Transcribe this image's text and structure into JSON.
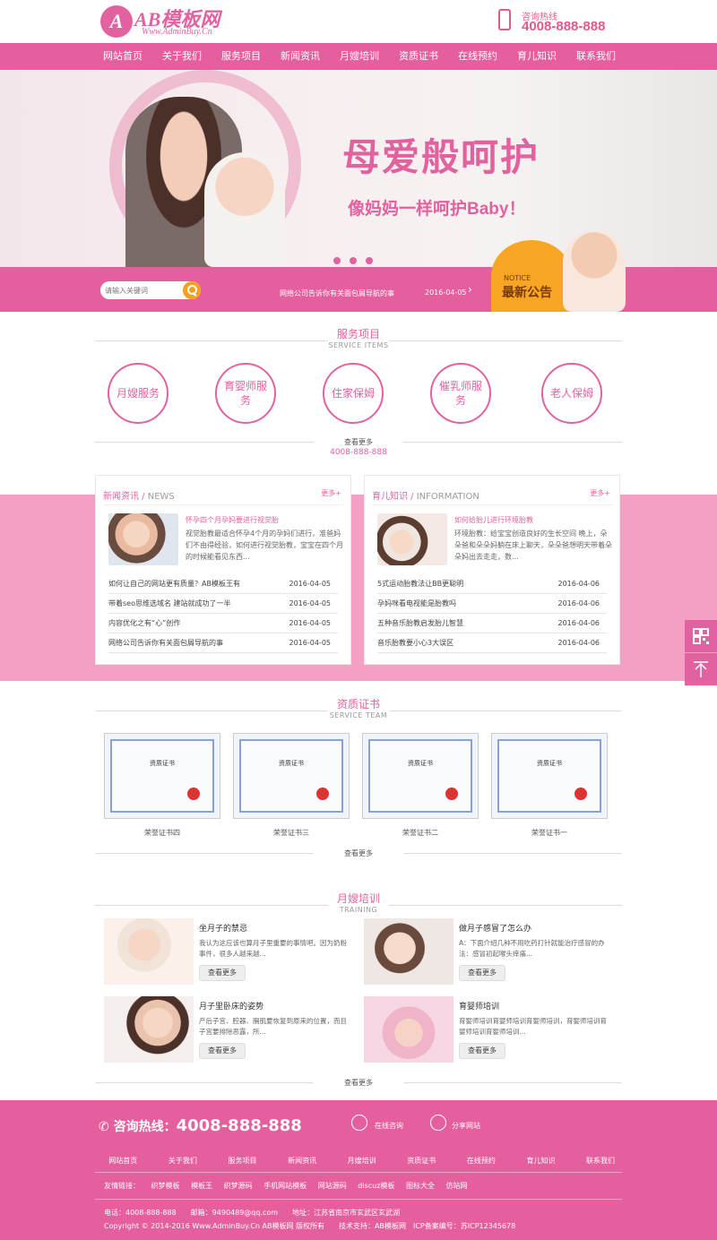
{
  "header": {
    "logo_mark": "A",
    "logo_text": "AB模板网",
    "logo_sub": "Www.AdminBuy.Cn",
    "hotline_label": "咨询热线",
    "hotline_number": "4008-888-888"
  },
  "nav": [
    "网站首页",
    "关于我们",
    "服务项目",
    "新闻资讯",
    "月嫂培训",
    "资质证书",
    "在线预约",
    "育儿知识",
    "联系我们"
  ],
  "banner": {
    "title": "母爱般呵护",
    "subtitle": "像妈妈一样呵护Baby！",
    "slide_count": 3
  },
  "notice": {
    "search_placeholder": "请输入关键词",
    "item_text": "网络公司告诉你有关面包屑导航的事",
    "item_date": "2016-04-05",
    "badge_en": "NOTICE",
    "badge_cn": "最新公告",
    "arrow": "›"
  },
  "services": {
    "title": "服务项目",
    "subtitle": "SERVICE ITEMS",
    "items": [
      "月嫂服务",
      "育婴师服务",
      "住家保姆",
      "催乳师服务",
      "老人保姆"
    ],
    "more": "查看更多",
    "phone": "4008-888-888"
  },
  "news": {
    "title": "新闻资讯",
    "title_en": "NEWS",
    "more": "更多+",
    "featured_title": "怀孕四个月孕妈要进行视觉胎",
    "featured_desc": "视觉胎教最适合怀孕4个月的孕妈们进行，准爸妈们不由得经验，如何进行视觉胎教，宝宝在四个月的时候能看见东西...",
    "list": [
      {
        "title": "如何让自己的网站更有质量？AB模板王有",
        "date": "2016-04-05"
      },
      {
        "title": "带着seo思维选域名 建站就成功了一半",
        "date": "2016-04-05"
      },
      {
        "title": "内容优化之有“心”创作",
        "date": "2016-04-05"
      },
      {
        "title": "网络公司告诉你有关面包屑导航的事",
        "date": "2016-04-05"
      }
    ]
  },
  "parenting": {
    "title": "育儿知识",
    "title_en": "INFORMATION",
    "more": "更多+",
    "featured_title": "如何给胎儿进行环境胎教",
    "featured_desc": "环境胎教：给宝宝创造良好的生长空间 晚上，朵朵爸和朵朵妈躺在床上聊天，朵朵爸想明天带着朵朵妈出去走走，数...",
    "list": [
      {
        "title": "5式运动胎教法让BB更聪明",
        "date": "2016-04-06"
      },
      {
        "title": "孕妈咪看电视能是胎教吗",
        "date": "2016-04-06"
      },
      {
        "title": "五种音乐胎教启发胎儿智慧",
        "date": "2016-04-06"
      },
      {
        "title": "音乐胎教要小心3大误区",
        "date": "2016-04-06"
      }
    ]
  },
  "certs": {
    "title": "资质证书",
    "subtitle": "SERVICE TEAM",
    "items": [
      "荣誉证书四",
      "荣誉证书三",
      "荣誉证书二",
      "荣誉证书一"
    ],
    "cert_heading": "资质证书",
    "more": "查看更多"
  },
  "training": {
    "title": "月嫂培训",
    "subtitle": "TRAINING",
    "button": "查看更多",
    "items": [
      {
        "title": "坐月子的禁忌",
        "desc": "我认为这应该也算月子里重要的事情吧。因为奶粉事件，很多人越来越..."
      },
      {
        "title": "做月子感冒了怎么办",
        "desc": "A：下面介绍几种不用吃药打针就能治疗感冒的办法：感冒初起喉头痒痛..."
      },
      {
        "title": "月子里卧床的姿势",
        "desc": "产后子宫、腔器、膈肌要恢复到原来的位置，而且子宫要排除恶露，所..."
      },
      {
        "title": "育婴师培训",
        "desc": "育婴师培训育婴师培训育婴师培训，育婴师培训育婴师培训育婴师培训..."
      }
    ],
    "more": "查看更多"
  },
  "footer": {
    "hotline_label": "咨询热线：",
    "hotline_number": "4008-888-888",
    "online": "在线咨询",
    "share": "分享网站",
    "nav": [
      "网站首页",
      "关于我们",
      "服务项目",
      "新闻资讯",
      "月嫂培训",
      "资质证书",
      "在线预约",
      "育儿知识",
      "联系我们"
    ],
    "links_label": "友情链接：",
    "links": [
      "织梦模板",
      "模板王",
      "织梦源码",
      "手机网站模板",
      "网站源码",
      "discuz模板",
      "图标大全",
      "仿站网"
    ],
    "contact": "电话：4008-888-888　　邮箱：9490489@qq.com　　地址：江苏省南京市玄武区玄武湖",
    "copyright": "Copyright © 2014-2016 Www.AdminBuy.Cn AB模板网 版权所有　　技术支持：AB模板网　ICP备案编号：苏ICP12345678"
  },
  "colors": {
    "brand": "#e55e9d",
    "accent": "#f6a623"
  }
}
